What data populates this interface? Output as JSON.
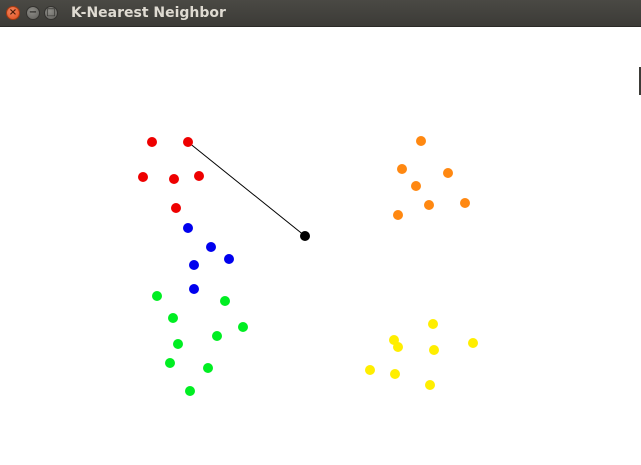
{
  "window": {
    "title": "K-Nearest Neighbor",
    "close_glyph": "×",
    "minimize_glyph": "−",
    "maximize_glyph": "□"
  },
  "colors": {
    "red": "#ee0000",
    "blue": "#0000ee",
    "green": "#00ee22",
    "orange": "#ff8811",
    "yellow": "#ffee00",
    "query": "#000000",
    "link": "#000000"
  },
  "chart_data": {
    "type": "scatter",
    "grid": false,
    "xlim": [
      0,
      641
    ],
    "ylim": [
      27,
      465
    ],
    "series": [
      {
        "color": "red",
        "points": [
          [
            152,
            142
          ],
          [
            188,
            142
          ],
          [
            143,
            177
          ],
          [
            174,
            179
          ],
          [
            199,
            176
          ],
          [
            176,
            208
          ]
        ]
      },
      {
        "color": "blue",
        "points": [
          [
            188,
            228
          ],
          [
            211,
            247
          ],
          [
            194,
            265
          ],
          [
            229,
            259
          ],
          [
            194,
            289
          ]
        ]
      },
      {
        "color": "green",
        "points": [
          [
            157,
            296
          ],
          [
            225,
            301
          ],
          [
            173,
            318
          ],
          [
            243,
            327
          ],
          [
            217,
            336
          ],
          [
            178,
            344
          ],
          [
            170,
            363
          ],
          [
            208,
            368
          ],
          [
            190,
            391
          ]
        ]
      },
      {
        "color": "orange",
        "points": [
          [
            421,
            141
          ],
          [
            402,
            169
          ],
          [
            448,
            173
          ],
          [
            416,
            186
          ],
          [
            429,
            205
          ],
          [
            465,
            203
          ],
          [
            398,
            215
          ]
        ]
      },
      {
        "color": "yellow",
        "points": [
          [
            433,
            324
          ],
          [
            394,
            340
          ],
          [
            398,
            347
          ],
          [
            434,
            350
          ],
          [
            473,
            343
          ],
          [
            370,
            370
          ],
          [
            395,
            374
          ],
          [
            430,
            385
          ]
        ]
      }
    ],
    "query_point": [
      305,
      236
    ],
    "nearest_links": [
      [
        [
          188,
          142
        ],
        [
          305,
          236
        ]
      ]
    ]
  }
}
